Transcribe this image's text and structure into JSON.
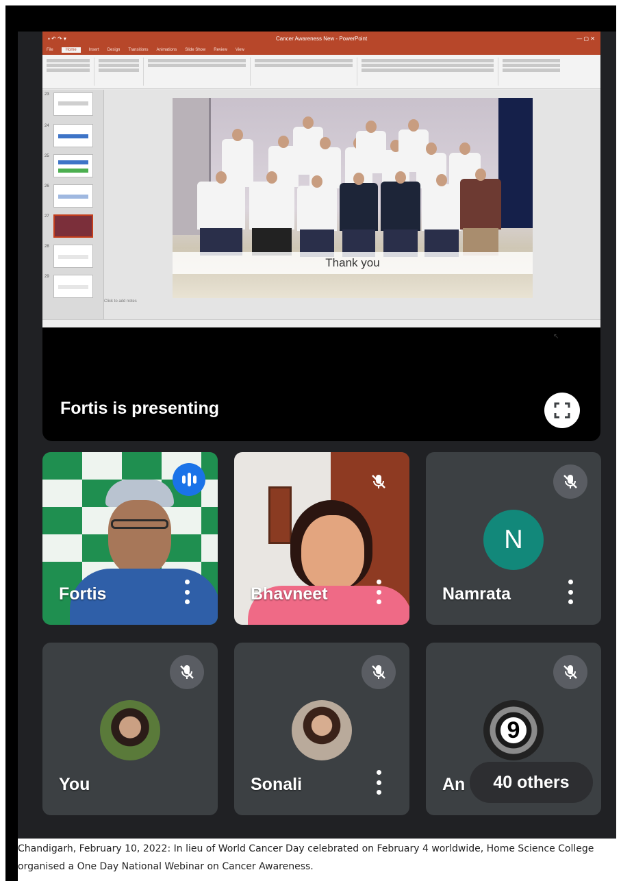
{
  "meet": {
    "presenting_label": "Fortis is presenting",
    "fullscreen_icon": "fullscreen-icon"
  },
  "ppt": {
    "window_title": "Cancer Awareness New - PowerPoint",
    "tabs": [
      "File",
      "Home",
      "Insert",
      "Design",
      "Transitions",
      "Animations",
      "Slide Show",
      "Review",
      "View"
    ],
    "slide_caption": "Thank you",
    "notes_placeholder": "Click to add notes",
    "thumb_numbers": [
      "23",
      "24",
      "25",
      "26",
      "27",
      "28",
      "29"
    ]
  },
  "participants": [
    {
      "name": "Fortis",
      "status": "speaking"
    },
    {
      "name": "Bhavneet",
      "status": "muted"
    },
    {
      "name": "Namrata",
      "status": "muted",
      "initial": "N"
    },
    {
      "name": "You",
      "status": "muted"
    },
    {
      "name": "Sonali",
      "status": "muted"
    },
    {
      "name": "An",
      "status": "muted",
      "avatar_text": "9",
      "others": "40 others"
    }
  ],
  "caption": "Chandigarh, February 10, 2022: In lieu of World Cancer Day celebrated on February 4 worldwide, Home Science College organised a One Day National Webinar on Cancer Awareness.",
  "colors": {
    "meet_bg": "#202124",
    "tile_bg": "#3c4043",
    "speaking": "#1a73e8",
    "avatar_n": "#12887a",
    "ppt_accent": "#b7472a"
  }
}
